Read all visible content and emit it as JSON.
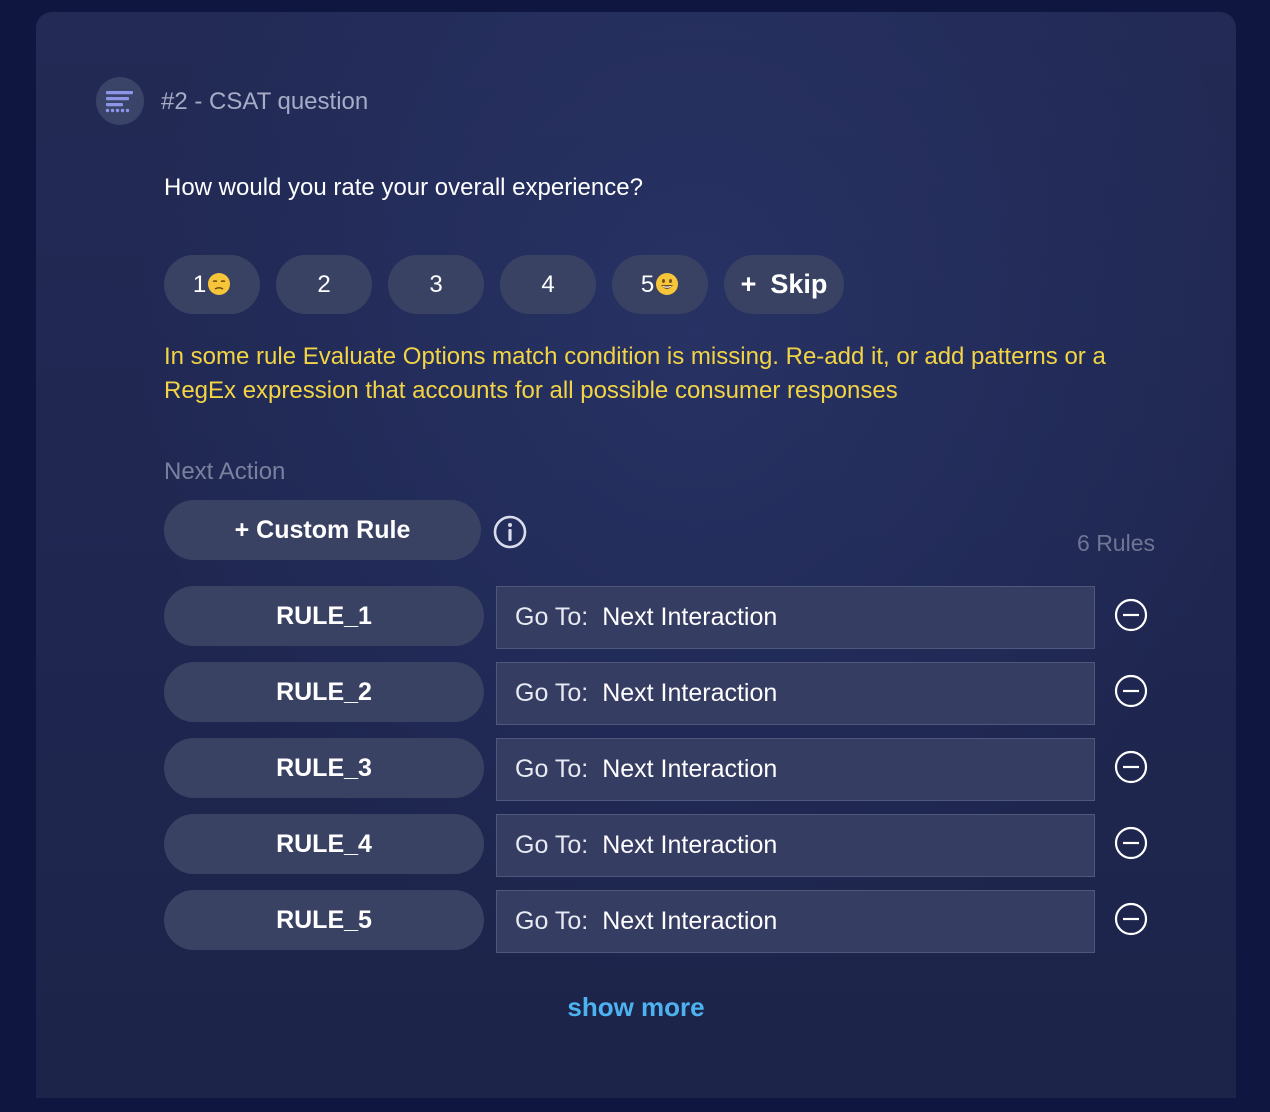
{
  "interaction": {
    "title": "#2 - CSAT question",
    "icon": "text-lines-icon",
    "question": "How would you rate your overall experience?"
  },
  "options": [
    {
      "label": "1",
      "emoji": "unamused-face-emoji"
    },
    {
      "label": "2"
    },
    {
      "label": "3"
    },
    {
      "label": "4"
    },
    {
      "label": "5",
      "emoji": "smiling-face-emoji"
    }
  ],
  "skip_label": "Skip",
  "skip_prefix": "+",
  "warning": "In some rule Evaluate Options match condition is missing. Re-add it, or add patterns or a RegEx expression that accounts for all possible consumer responses",
  "next_action": {
    "label": "Next Action",
    "custom_rule_label": "+ Custom Rule",
    "info_icon": "info-circle-icon",
    "rules_count": "6 Rules"
  },
  "rules": [
    {
      "name": "RULE_1",
      "goto_prefix": "Go To:",
      "goto_value": "Next Interaction"
    },
    {
      "name": "RULE_2",
      "goto_prefix": "Go To:",
      "goto_value": "Next Interaction"
    },
    {
      "name": "RULE_3",
      "goto_prefix": "Go To:",
      "goto_value": "Next Interaction"
    },
    {
      "name": "RULE_4",
      "goto_prefix": "Go To:",
      "goto_value": "Next Interaction"
    },
    {
      "name": "RULE_5",
      "goto_prefix": "Go To:",
      "goto_value": "Next Interaction"
    }
  ],
  "show_more_label": "show more",
  "colors": {
    "warning": "#f2d444",
    "link": "#4db3f0",
    "pill": "#3a4264",
    "background": "#0f1740"
  }
}
